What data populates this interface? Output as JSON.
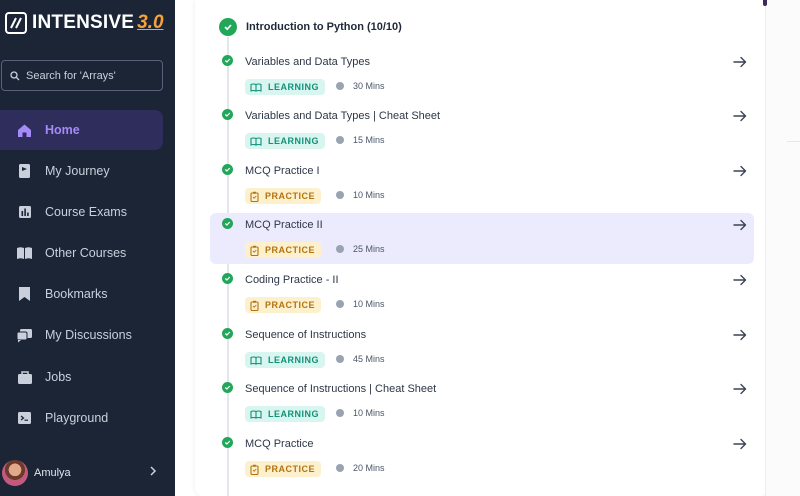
{
  "brand": {
    "name": "INTENSIVE",
    "version": "3.0"
  },
  "search": {
    "placeholder": "Search for 'Arrays'"
  },
  "nav": [
    {
      "label": "Home",
      "icon": "home-icon",
      "active": true
    },
    {
      "label": "My Journey",
      "icon": "journey-icon",
      "active": false
    },
    {
      "label": "Course Exams",
      "icon": "exams-icon",
      "active": false
    },
    {
      "label": "Other Courses",
      "icon": "book-icon",
      "active": false
    },
    {
      "label": "Bookmarks",
      "icon": "bookmark-icon",
      "active": false
    },
    {
      "label": "My Discussions",
      "icon": "discussion-icon",
      "active": false
    },
    {
      "label": "Jobs",
      "icon": "briefcase-icon",
      "active": false
    },
    {
      "label": "Playground",
      "icon": "terminal-icon",
      "active": false
    }
  ],
  "profile": {
    "name": "Amulya"
  },
  "module": {
    "title": "Introduction to Python (10/10)"
  },
  "items": [
    {
      "title": "Variables and Data Types",
      "type": "LEARNING",
      "duration": "30 Mins",
      "selected": false
    },
    {
      "title": "Variables and Data Types | Cheat Sheet",
      "type": "LEARNING",
      "duration": "15 Mins",
      "selected": false
    },
    {
      "title": "MCQ Practice I",
      "type": "PRACTICE",
      "duration": "10 Mins",
      "selected": false
    },
    {
      "title": "MCQ Practice II",
      "type": "PRACTICE",
      "duration": "25 Mins",
      "selected": true
    },
    {
      "title": "Coding Practice - II",
      "type": "PRACTICE",
      "duration": "10 Mins",
      "selected": false
    },
    {
      "title": "Sequence of Instructions",
      "type": "LEARNING",
      "duration": "45 Mins",
      "selected": false
    },
    {
      "title": "Sequence of Instructions | Cheat Sheet",
      "type": "LEARNING",
      "duration": "10 Mins",
      "selected": false
    },
    {
      "title": "MCQ Practice",
      "type": "PRACTICE",
      "duration": "20 Mins",
      "selected": false
    }
  ],
  "colors": {
    "sidebar": "#1b2536",
    "active_nav_bg": "#2f2d5c",
    "active_nav_text": "#a48bf5",
    "complete_green": "#22a75a",
    "learning_bg": "#d8f6ef",
    "learning_text": "#12917a",
    "practice_bg": "#fdf0cd",
    "practice_text": "#b4730f",
    "selected_row": "#ecebfd",
    "brand_version": "#f7a23b"
  }
}
